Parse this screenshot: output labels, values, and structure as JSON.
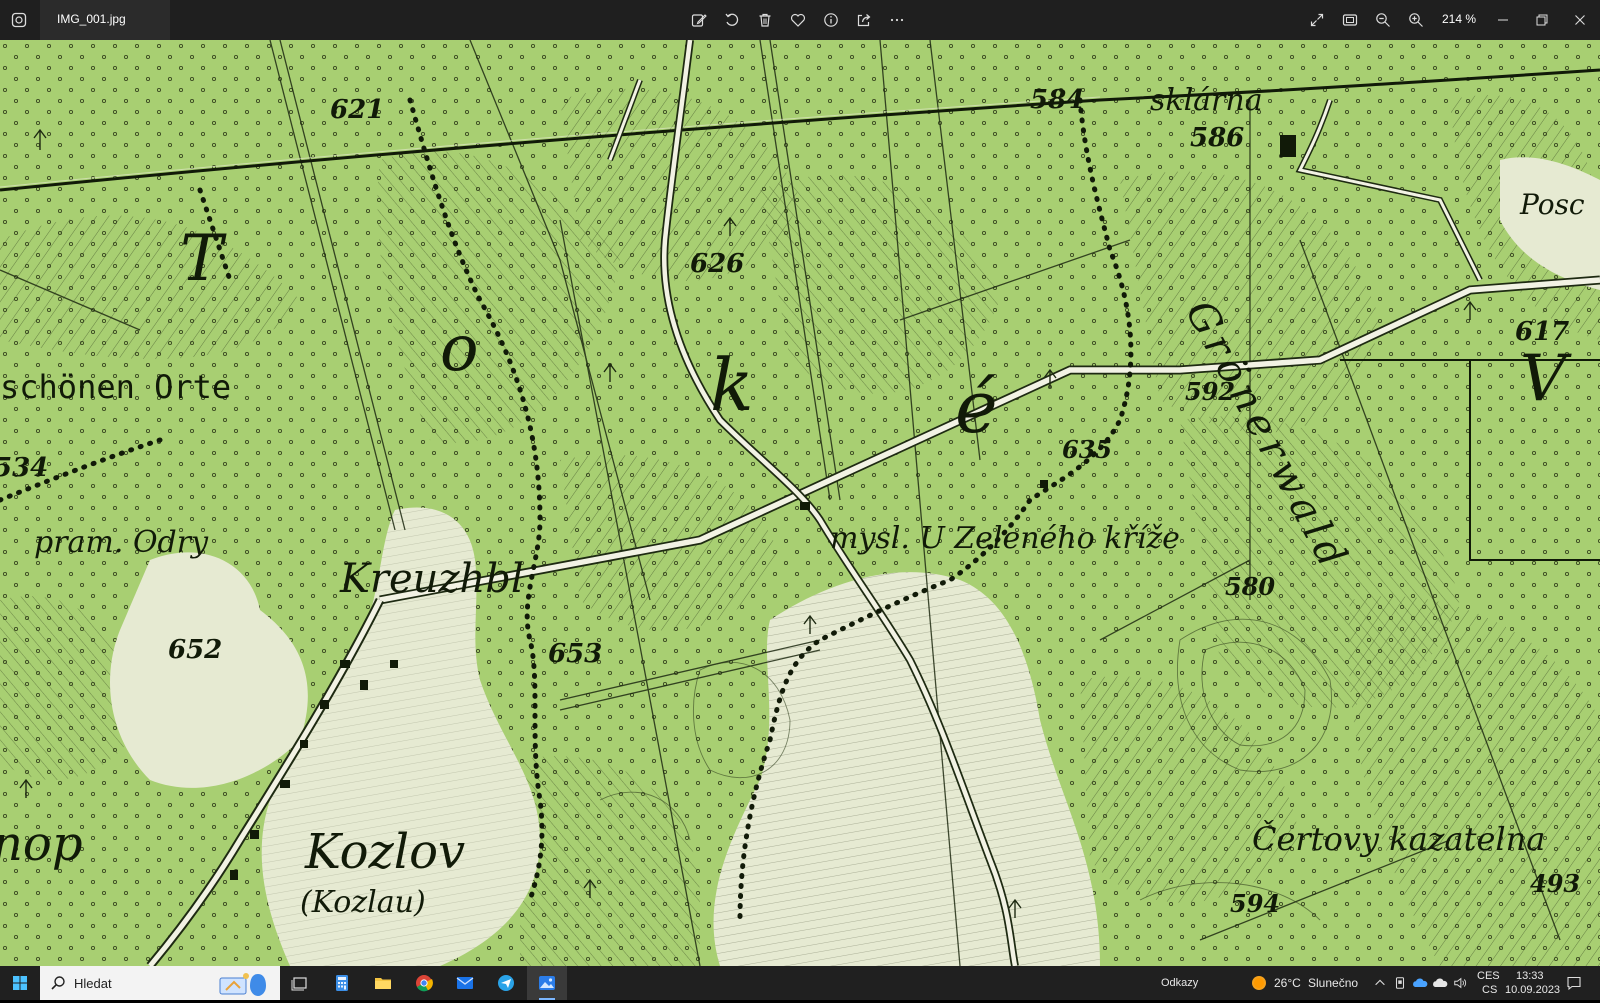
{
  "window": {
    "filename": "IMG_001.jpg",
    "zoom": "214 %"
  },
  "map": {
    "labels": {
      "sklarna": "sklárna",
      "e584": "584",
      "e586": "586",
      "e621": "621",
      "e626": "626",
      "pose": "Posc",
      "e617": "617",
      "e592": "592",
      "e635": "635",
      "e534": "534",
      "schonen": "schönen Orte",
      "pram": "pram. Odry",
      "kreuzhbl": "Kreuzhbl",
      "myslivna": "mysl. U Zeleného kříže",
      "e580": "580",
      "e652": "652",
      "e653": "653",
      "kozlov": "Kozlov",
      "kozlau": "(Kozlau)",
      "certovy": "Čertovy kazatelna",
      "e493": "493",
      "e594": "594",
      "opi": "nop",
      "l_t": "T",
      "l_o": "o",
      "l_k": "k",
      "l_e": "é",
      "l_v": "V",
      "gronau": "Grönerwald"
    }
  },
  "taskbar": {
    "search_placeholder": "Hledat",
    "odkazy": "Odkazy",
    "weather_temp": "26°C",
    "weather_desc": "Slunečno",
    "lang_top": "CES",
    "lang_bottom": "CS",
    "time": "13:33",
    "date": "10.09.2023"
  },
  "colors": {
    "titlebar": "#1f1f1f",
    "map_green": "#a8cf72",
    "map_clear": "#e6ead2",
    "map_ink": "#1e2a12",
    "taskbar": "#202020",
    "accent": "#7bb6ff"
  }
}
